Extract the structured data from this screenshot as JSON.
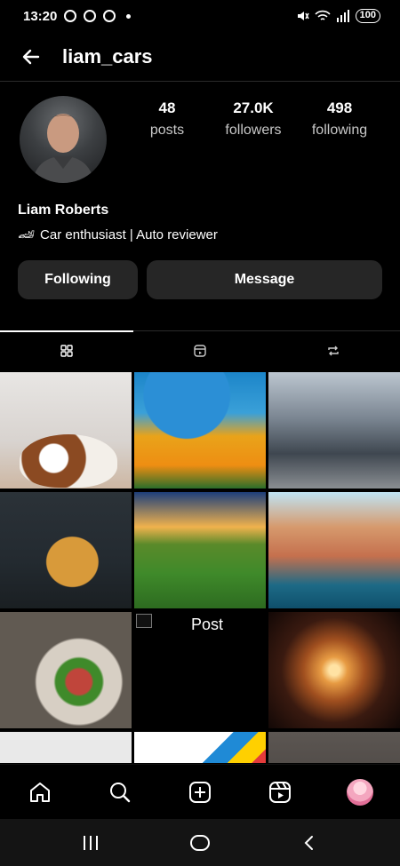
{
  "status_bar": {
    "time": "13:20",
    "battery": "100"
  },
  "header": {
    "username": "liam_cars"
  },
  "profile": {
    "stats": [
      {
        "value": "48",
        "label": "posts"
      },
      {
        "value": "27.0K",
        "label": "followers"
      },
      {
        "value": "498",
        "label": "following"
      }
    ],
    "name": "Liam Roberts",
    "bio": "Car enthusiast | Auto reviewer",
    "bio_emoji": "🏎"
  },
  "actions": {
    "following": "Following",
    "message": "Message"
  },
  "tabs": [
    {
      "icon": "grid-icon",
      "active": true
    },
    {
      "icon": "reels-icon",
      "active": false
    },
    {
      "icon": "repost-icon",
      "active": false
    }
  ],
  "grid": {
    "broken_post_label": "Post"
  },
  "colors": {
    "background": "#000000",
    "button": "#262626",
    "text": "#ffffff",
    "muted_text": "#c8c8c8"
  }
}
